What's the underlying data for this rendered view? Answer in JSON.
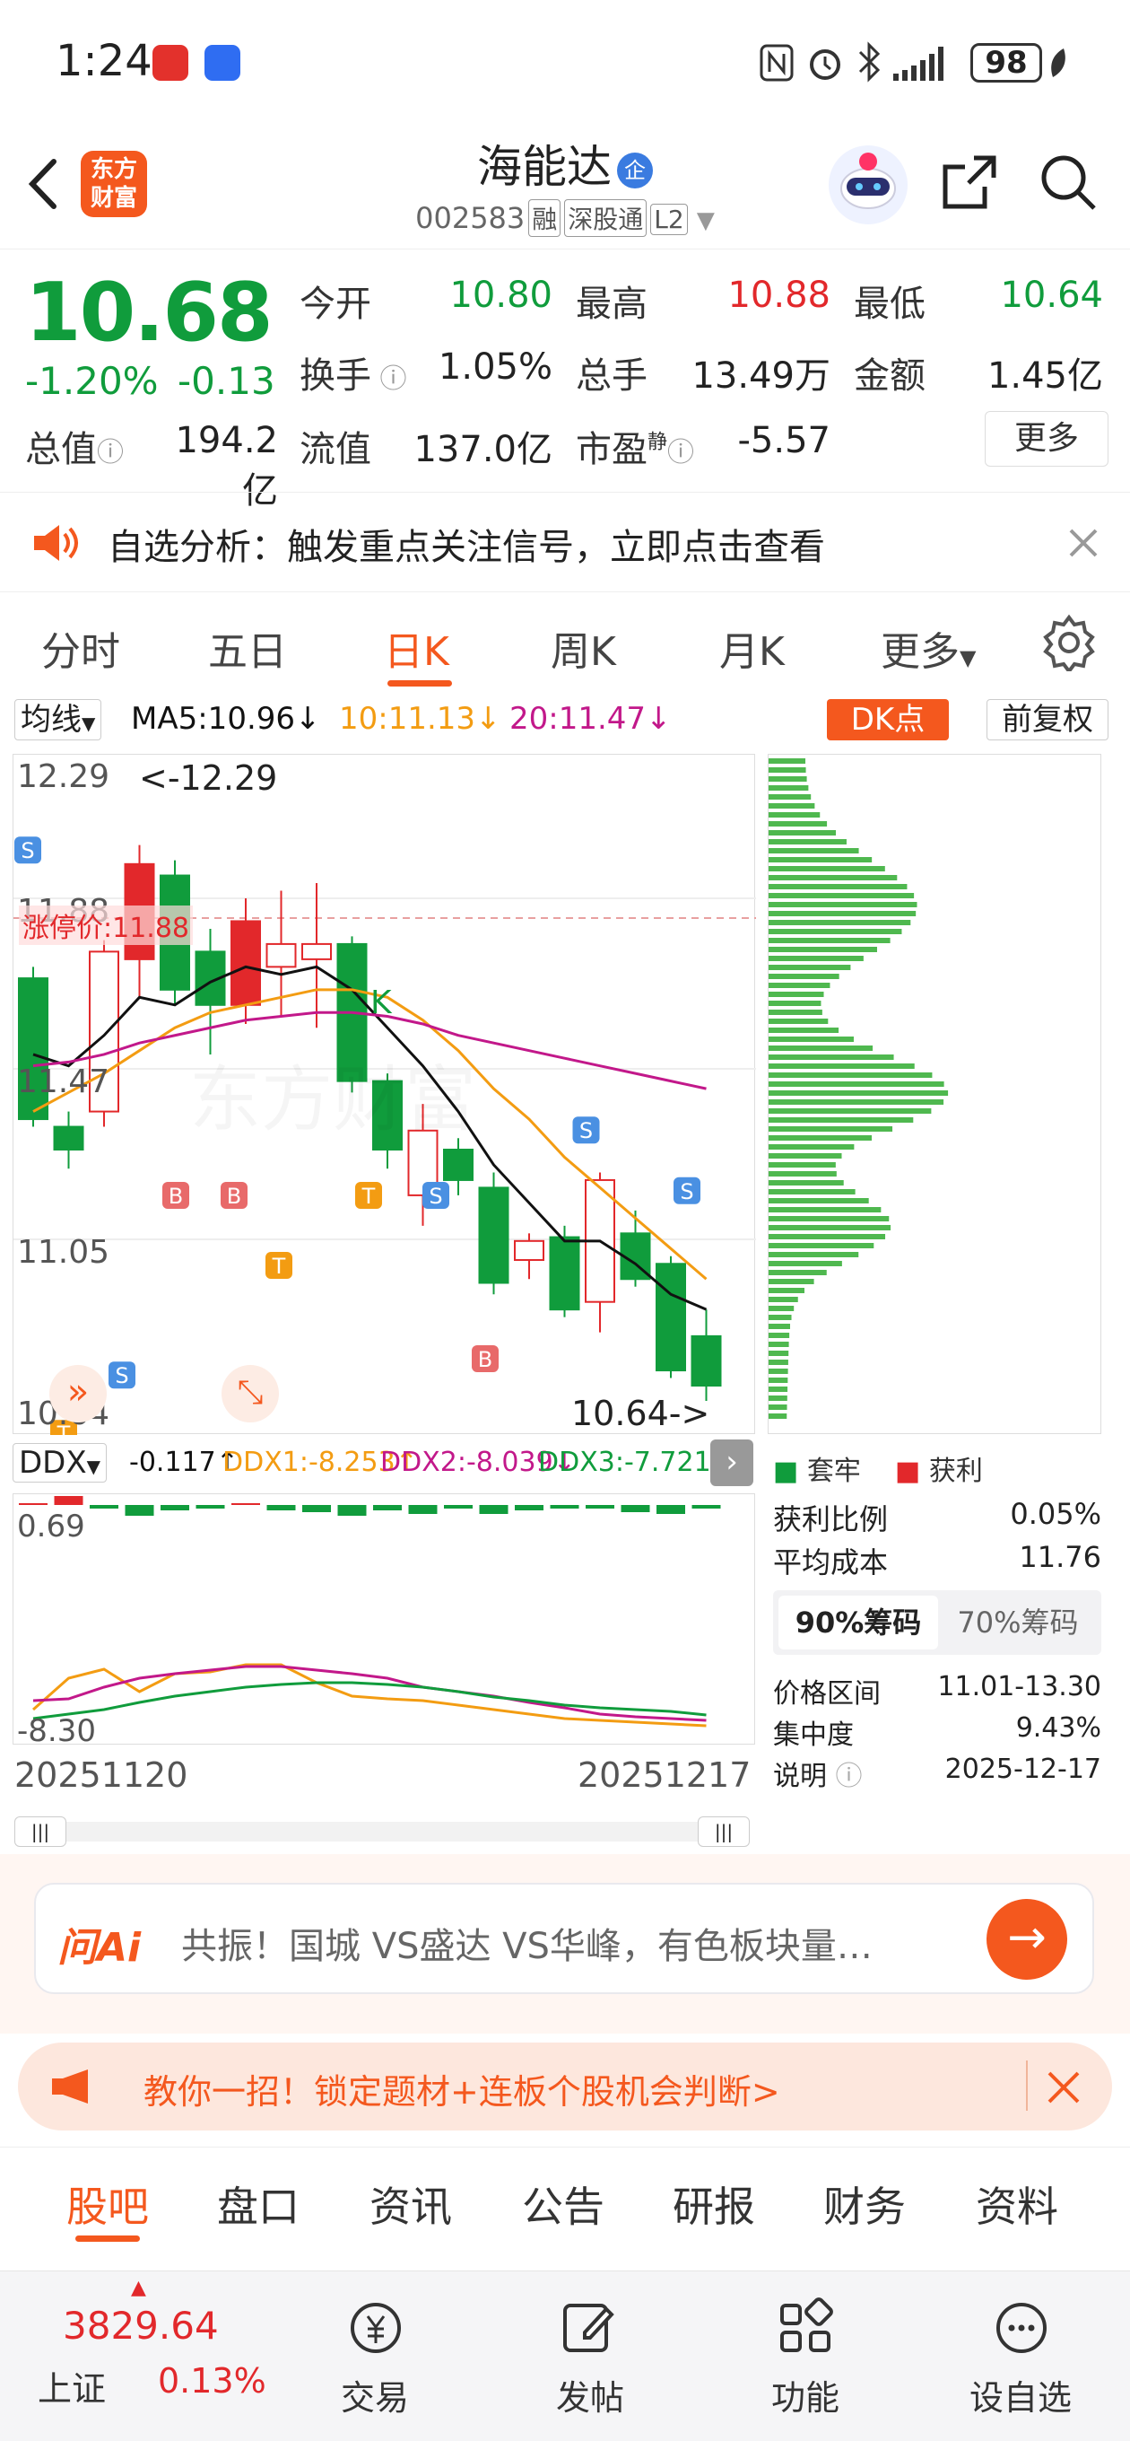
{
  "status": {
    "time": "1:24",
    "battery": "98"
  },
  "header": {
    "logo": "东方财富",
    "name": "海能达",
    "qi_badge": "企",
    "code": "002583",
    "tags": [
      "融",
      "深股通",
      "L2"
    ]
  },
  "quote": {
    "price": "10.68",
    "change_pct": "-1.20%",
    "change_abs": "-0.13",
    "open_label": "今开",
    "open": "10.80",
    "high_label": "最高",
    "high": "10.88",
    "low_label": "最低",
    "low": "10.64",
    "turnover_label": "换手",
    "turnover": "1.05%",
    "volume_label": "总手",
    "volume": "13.49万",
    "amount_label": "金额",
    "amount": "1.45亿",
    "mktcap_label": "总值",
    "mktcap": "194.2亿",
    "float_label": "流值",
    "float": "137.0亿",
    "pe_label": "市盈",
    "pe_sup": "静",
    "pe": "-5.57",
    "more": "更多"
  },
  "notice": {
    "text": "自选分析：触发重点关注信号，立即点击查看"
  },
  "tabs": [
    "分时",
    "五日",
    "日K",
    "周K",
    "月K",
    "更多"
  ],
  "active_tab": "日K",
  "chart": {
    "ma_select": "均线",
    "ma5": "MA5:10.96",
    "ma10": "10:11.13",
    "ma20": "20:11.47",
    "dk_button": "DK点",
    "adjust": "前复权",
    "y_top": "12.29",
    "y_mid1": "11.88",
    "y_mid2": "11.47",
    "y_mid3": "11.05",
    "y_bottom": "10.64",
    "high_marker": "<-12.29",
    "low_marker": "10.64->",
    "limit_label": "涨停价:11.88",
    "watermark": "东方财富",
    "k_label": "K",
    "ddx_select": "DDX",
    "ddx": "-0.117",
    "ddx1": "DDX1:-8.253",
    "ddx2": "DDX2:-8.039",
    "ddx3": "DDX3:-7.721",
    "ind_top": "0.69",
    "ind_bottom": "-8.30",
    "date_start": "20251120",
    "date_end": "20251217",
    "colors": {
      "up": "#e2282b",
      "down": "#109c3c",
      "ma5": "#111111",
      "ma10": "#f39c12",
      "ma20": "#c2188a"
    }
  },
  "chip": {
    "legend_locked": "套牢",
    "legend_profit": "获利",
    "profit_ratio_label": "获利比例",
    "profit_ratio": "0.05%",
    "avg_cost_label": "平均成本",
    "avg_cost": "11.76",
    "tab90": "90%筹码",
    "tab70": "70%筹码",
    "range_label": "价格区间",
    "range": "11.01-13.30",
    "concentration_label": "集中度",
    "concentration": "9.43%",
    "note_label": "说明",
    "note_date": "2025-12-17"
  },
  "ai": {
    "logo": "问Ai",
    "placeholder": "共振！国城 VS盛达 VS华峰，有色板块量…"
  },
  "promo": {
    "text": "教你一招！锁定题材+连板个股机会判断>"
  },
  "subtabs": [
    "股吧",
    "盘口",
    "资讯",
    "公告",
    "研报",
    "财务",
    "资料"
  ],
  "bottom": {
    "index_value": "3829.64",
    "index_name": "上证",
    "index_change": "0.13%",
    "items": [
      "交易",
      "发帖",
      "功能",
      "设自选"
    ]
  }
}
